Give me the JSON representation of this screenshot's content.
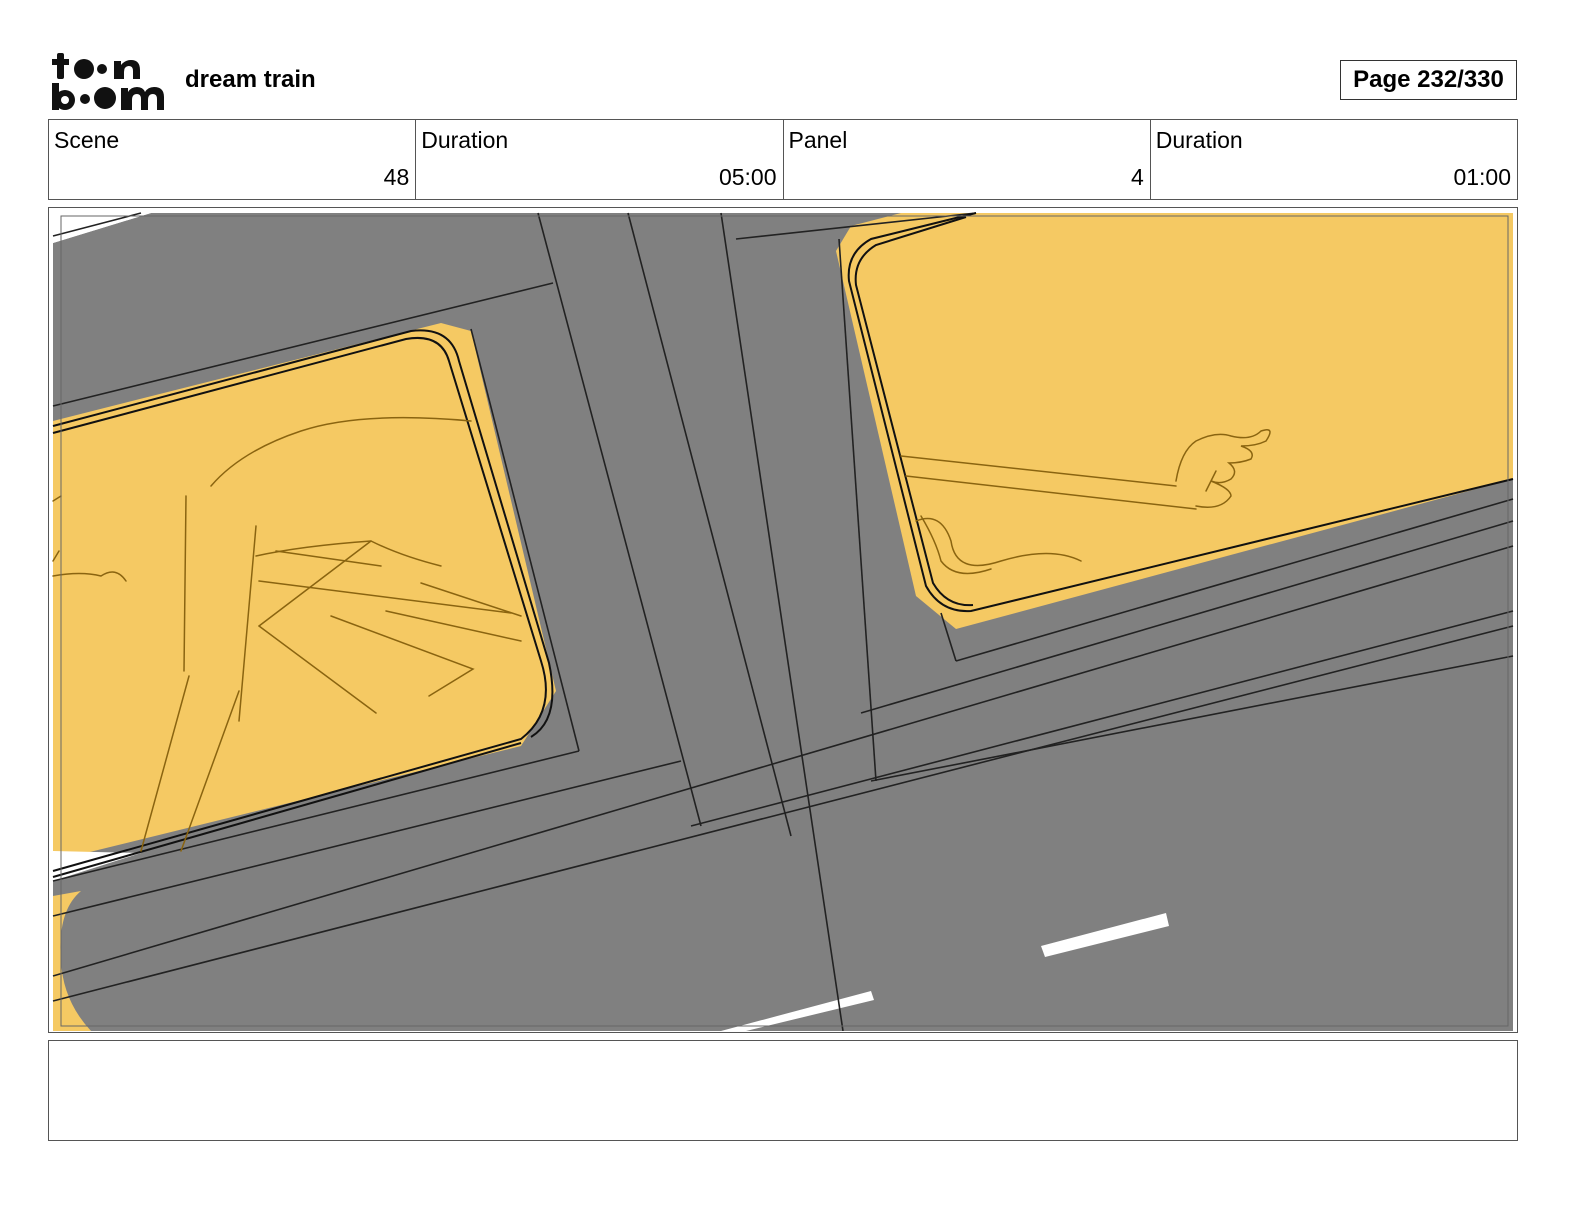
{
  "header": {
    "logo_text": "toonboom",
    "project_title": "dream train",
    "page_label": "Page 232/330"
  },
  "info": {
    "scene_label": "Scene",
    "scene_value": "48",
    "scene_duration_label": "Duration",
    "scene_duration_value": "05:00",
    "panel_label": "Panel",
    "panel_value": "4",
    "panel_duration_label": "Duration",
    "panel_duration_value": "01:00"
  },
  "colors": {
    "road": "#808080",
    "car": "#f5c963",
    "line": "#222222",
    "sketch": "#8a6410",
    "marking": "#ffffff"
  },
  "notes": {
    "text": ""
  }
}
